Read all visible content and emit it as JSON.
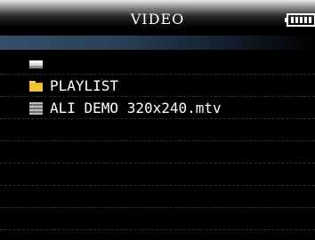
{
  "header": {
    "title": "VIDEO",
    "battery_icon": "battery-full-icon"
  },
  "file_list": {
    "items": [
      {
        "icon": "parent-folder-icon",
        "label": ""
      },
      {
        "icon": "folder-icon",
        "label": "PLAYLIST"
      },
      {
        "icon": "video-file-icon",
        "label": "ALI DEMO 320x240.mtv"
      }
    ],
    "empty_rows": 6
  },
  "colors": {
    "background": "#000000",
    "title_bar_top": "#e6e6e6",
    "path_bar": "#344f6a",
    "folder": "#f2c434",
    "divider": "#2f2f2f"
  }
}
